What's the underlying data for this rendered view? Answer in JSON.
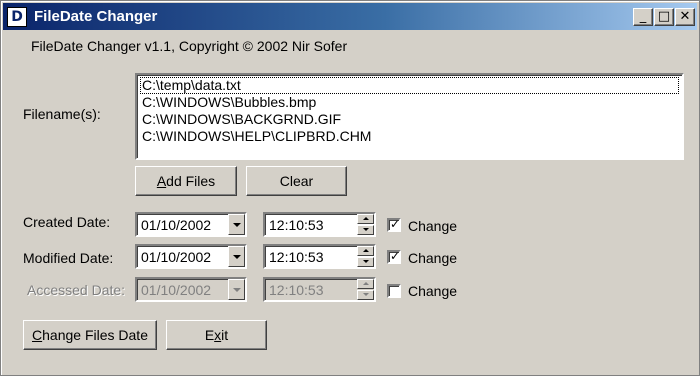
{
  "window": {
    "title": "FileDate Changer",
    "icon_letter": "D",
    "min_glyph": "_",
    "max_glyph": "□",
    "close_glyph": "✕"
  },
  "copyright": "FileDate Changer v1.1, Copyright © 2002 Nir Sofer",
  "filenames_label": "Filename(s):",
  "files": [
    "C:\\temp\\data.txt",
    "C:\\WINDOWS\\Bubbles.bmp",
    "C:\\WINDOWS\\BACKGRND.GIF",
    "C:\\WINDOWS\\HELP\\CLIPBRD.CHM"
  ],
  "buttons": {
    "add_files_ul": "A",
    "add_files_rest": "dd Files",
    "clear": "Clear",
    "change_files_date_ul": "C",
    "change_files_date_rest": "hange Files Date",
    "exit_pre": "E",
    "exit_ul": "x",
    "exit_post": "it"
  },
  "dates": {
    "created": {
      "label": "Created Date:",
      "date": "01/10/2002",
      "time": "12:10:53",
      "change_label": "Change",
      "checked": true,
      "check_glyph": "✓"
    },
    "modified": {
      "label": "Modified Date:",
      "date": "01/10/2002",
      "time": "12:10:53",
      "change_label": "Change",
      "checked": true,
      "check_glyph": "✓"
    },
    "accessed": {
      "label": "Accessed Date:",
      "date": "01/10/2002",
      "time": "12:10:53",
      "change_label": "Change",
      "checked": false
    }
  }
}
